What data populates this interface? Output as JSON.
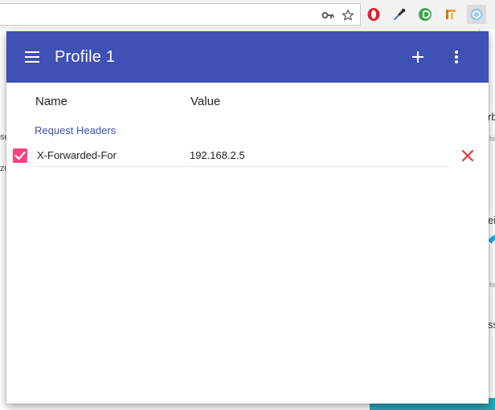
{
  "browser": {
    "toolbar_icons": [
      "key-icon",
      "star-icon"
    ],
    "extensions": [
      "opera-icon",
      "eyedropper-icon",
      "green-circle-icon",
      "bar-icon",
      "modheader-icon"
    ],
    "background_fragments": [
      "se",
      "zu",
      "rb",
      "hi",
      "ei",
      "hi",
      "ss"
    ]
  },
  "popup": {
    "title": "Profile 1",
    "colors": {
      "appbar": "#3f51b5",
      "accent": "#ff4081",
      "delete": "#e53935"
    },
    "columns": {
      "name": "Name",
      "value": "Value"
    },
    "section": "Request Headers",
    "headers": [
      {
        "enabled": true,
        "name": "X-Forwarded-For",
        "value": "192.168.2.5"
      }
    ]
  }
}
